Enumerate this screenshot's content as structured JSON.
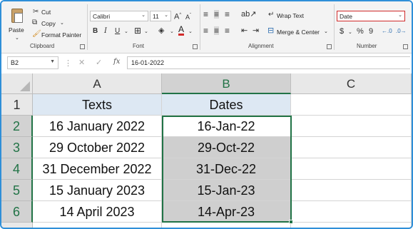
{
  "ribbon": {
    "clipboard": {
      "paste": "Paste",
      "cut": "Cut",
      "copy": "Copy",
      "format_painter": "Format Painter",
      "group_label": "Clipboard"
    },
    "font": {
      "font_name": "Calibri",
      "font_size": "11",
      "bold": "B",
      "italic": "I",
      "underline": "U",
      "group_label": "Font"
    },
    "alignment": {
      "wrap_text": "Wrap Text",
      "merge_center": "Merge & Center",
      "group_label": "Alignment"
    },
    "number": {
      "format": "Date",
      "currency": "$",
      "percent": "%",
      "comma": "9",
      "group_label": "Number"
    }
  },
  "formula_bar": {
    "name_box": "B2",
    "fx": "fx",
    "value": "16-01-2022"
  },
  "sheet": {
    "columns": [
      "A",
      "B",
      "C"
    ],
    "rows": [
      "1",
      "2",
      "3",
      "4",
      "5",
      "6"
    ],
    "header_row": [
      "Texts",
      "Dates"
    ],
    "data": [
      [
        "16 January 2022",
        "16-Jan-22"
      ],
      [
        "29 October 2022",
        "29-Oct-22"
      ],
      [
        "31 December 2022",
        "31-Dec-22"
      ],
      [
        "15 January 2023",
        "15-Jan-23"
      ],
      [
        "14 April 2023",
        "14-Apr-23"
      ]
    ]
  },
  "colors": {
    "accent_green": "#217346",
    "header_fill": "#dde8f3",
    "selection_fill": "#cfcfcf",
    "frame_border": "#2f8fd8"
  }
}
